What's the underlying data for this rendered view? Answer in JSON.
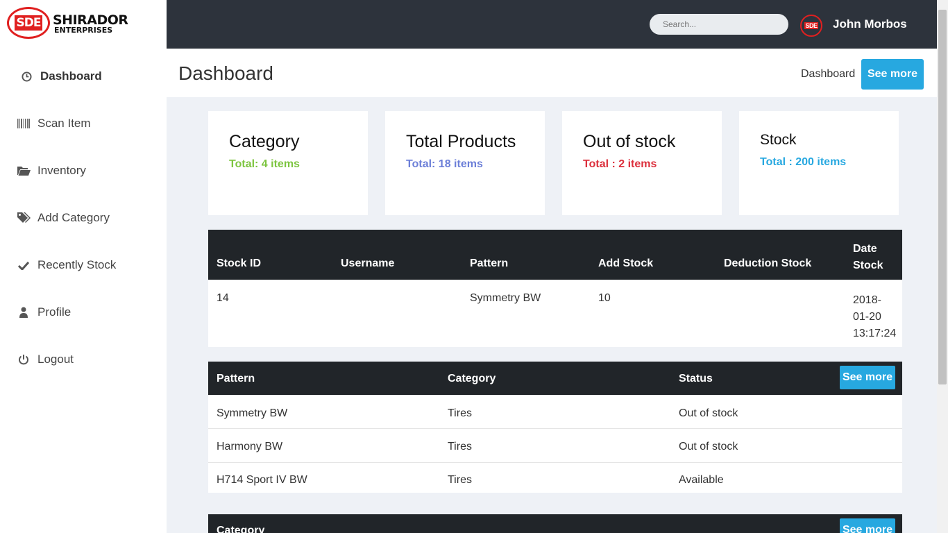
{
  "brand": {
    "badge": "SDE",
    "name": "SHIRADOR",
    "sub": "ENTERPRISES"
  },
  "sidebar": {
    "items": [
      {
        "label": "Dashboard",
        "icon": "clock-icon"
      },
      {
        "label": "Scan Item",
        "icon": "barcode-icon"
      },
      {
        "label": "Inventory",
        "icon": "folder-open-icon"
      },
      {
        "label": "Add Category",
        "icon": "tags-icon"
      },
      {
        "label": "Recently Stock",
        "icon": "check-icon"
      },
      {
        "label": "Profile",
        "icon": "user-icon"
      },
      {
        "label": "Logout",
        "icon": "power-icon"
      }
    ]
  },
  "topbar": {
    "search_placeholder": "Search...",
    "avatar_badge": "SDE",
    "username": "John Morbos"
  },
  "header": {
    "title": "Dashboard",
    "breadcrumb": "Dashboard",
    "see_more": "See more"
  },
  "cards": [
    {
      "title": "Category",
      "sub": "Total: 4 items",
      "color": "#7dc540"
    },
    {
      "title": "Total Products",
      "sub": "Total: 18 items",
      "color": "#6c7fd8"
    },
    {
      "title": "Out of stock",
      "sub": "Total : 2 items",
      "color": "#dc2f3c"
    },
    {
      "title": "Stock",
      "sub": "Total : 200 items",
      "color": "#27a8e0"
    }
  ],
  "stock_table": {
    "headers": [
      "Stock ID",
      "Username",
      "Pattern",
      "Add Stock",
      "Deduction Stock",
      "Date Stock"
    ],
    "rows": [
      {
        "stock_id": "14",
        "username": "",
        "pattern": "Symmetry BW",
        "add_stock": "10",
        "deduction_stock": "",
        "date_stock": [
          "2018-",
          "01-20",
          "13:17:24"
        ]
      }
    ]
  },
  "products_table": {
    "headers": [
      "Pattern",
      "Category",
      "Status"
    ],
    "see_more": "See more",
    "rows": [
      {
        "pattern": "Symmetry BW",
        "category": "Tires",
        "status": "Out of stock"
      },
      {
        "pattern": "Harmony BW",
        "category": "Tires",
        "status": "Out of stock"
      },
      {
        "pattern": "H714 Sport IV BW",
        "category": "Tires",
        "status": "Available"
      }
    ]
  },
  "category_table": {
    "headers": [
      "Category"
    ],
    "see_more": "See more"
  },
  "colors": {
    "topbar": "#2d333c",
    "table_head": "#212529",
    "accent": "#27a8e0",
    "brand_red": "#e02020"
  }
}
